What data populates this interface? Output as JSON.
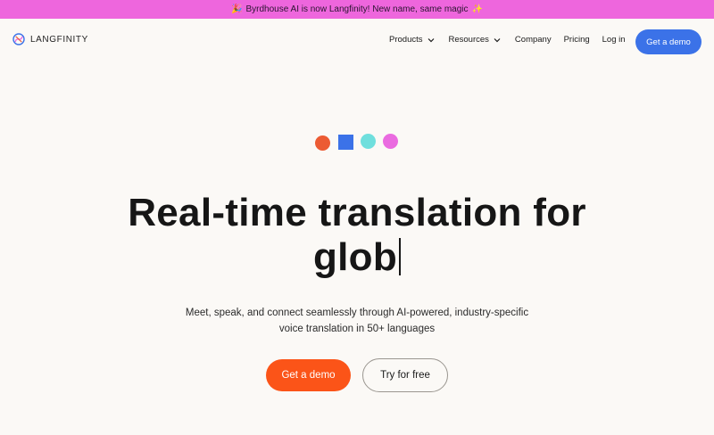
{
  "announcement": {
    "left_emoji": "🎉",
    "text": "Byrdhouse AI is now Langfinity! New name, same magic",
    "right_emoji": "✨"
  },
  "nav": {
    "brand": "LANGFINITY",
    "items": [
      {
        "label": "Products",
        "has_dropdown": true
      },
      {
        "label": "Resources",
        "has_dropdown": true
      },
      {
        "label": "Company",
        "has_dropdown": false
      },
      {
        "label": "Pricing",
        "has_dropdown": false
      },
      {
        "label": "Log in",
        "has_dropdown": false
      }
    ],
    "cta": "Get a demo"
  },
  "hero": {
    "headline_line1": "Real-time translation for",
    "headline_line2": "glob",
    "subheading": "Meet, speak, and connect seamlessly through AI-powered, industry-specific voice translation in 50+ languages",
    "primary_cta": "Get a demo",
    "secondary_cta": "Try for free"
  },
  "colors": {
    "banner": "#ee66dd",
    "blue": "#3b72e8",
    "orange": "#fb5418",
    "cyan": "#6fdfdd",
    "pink": "#ea6be0",
    "background": "#fbf9f6"
  }
}
